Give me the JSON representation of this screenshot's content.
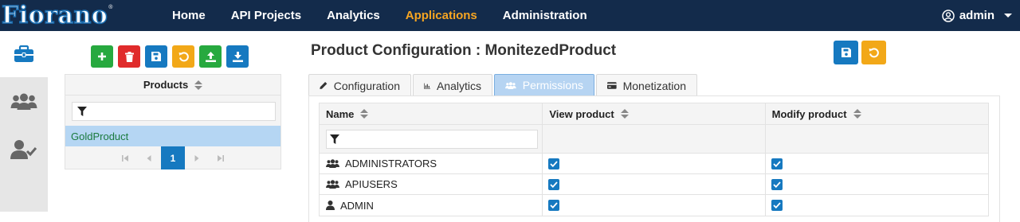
{
  "app": {
    "logo_text": "Fiorano",
    "logo_tm": "®"
  },
  "nav": {
    "items": [
      {
        "label": "Home",
        "active": false
      },
      {
        "label": "API Projects",
        "active": false
      },
      {
        "label": "Analytics",
        "active": false
      },
      {
        "label": "Applications",
        "active": true
      },
      {
        "label": "Administration",
        "active": false
      }
    ],
    "user": "admin"
  },
  "rail": {
    "items": [
      {
        "icon": "briefcase-icon",
        "active": true
      },
      {
        "icon": "users-icon",
        "active": false
      },
      {
        "icon": "user-check-icon",
        "active": false
      }
    ]
  },
  "products": {
    "toolbar": [
      "add-icon",
      "delete-icon",
      "save-icon",
      "undo-icon",
      "upload-icon",
      "download-icon"
    ],
    "header": "Products",
    "items": [
      "GoldProduct"
    ],
    "pager": {
      "current": "1"
    }
  },
  "main": {
    "title": "Product Configuration : MonitezedProduct",
    "tabs": [
      {
        "label": "Configuration",
        "icon": "pencil-icon",
        "active": false
      },
      {
        "label": "Analytics",
        "icon": "bar-chart-icon",
        "active": false
      },
      {
        "label": "Permissions",
        "icon": "users-icon",
        "active": true
      },
      {
        "label": "Monetization",
        "icon": "credit-card-icon",
        "active": false
      }
    ],
    "permissions": {
      "columns": [
        "Name",
        "View product",
        "Modify product"
      ],
      "rows": [
        {
          "name": "ADMINISTRATORS",
          "icon": "users-icon",
          "view": true,
          "modify": true
        },
        {
          "name": "APIUSERS",
          "icon": "users-icon",
          "view": true,
          "modify": true
        },
        {
          "name": "ADMIN",
          "icon": "user-icon",
          "view": true,
          "modify": true
        }
      ]
    }
  },
  "colors": {
    "navbar": "#132b4b",
    "accent": "#f6a522",
    "primary": "#1679c0",
    "green": "#27a93f",
    "red": "#e02b2b",
    "orange": "#f2a818"
  }
}
